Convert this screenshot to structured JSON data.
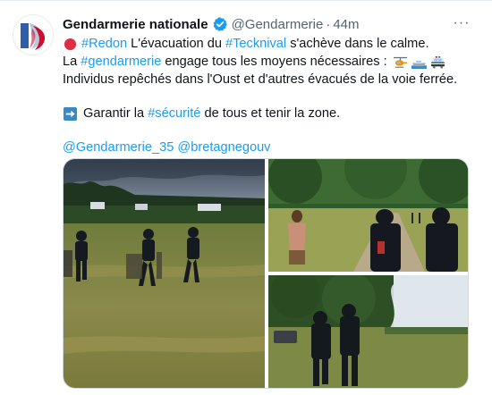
{
  "tweet": {
    "author_name": "Gendarmerie nationale",
    "handle": "@Gendarmerie",
    "separator": "·",
    "time": "44m",
    "more_label": "···",
    "lines": [
      {
        "before": "",
        "tag1": "#Redon",
        "mid": " L'évacuation du ",
        "tag2": "#Tecknival",
        "after": " s'achève dans le calme."
      },
      {
        "before": "La ",
        "tag1": "#gendarmerie",
        "after": " engage tous les moyens nécessaires :"
      },
      {
        "text": "Individus repêchés dans l'Oust et d'autres évacués de la voie ferrée."
      },
      {
        "before": "Garantir la ",
        "tag1": "#sécurité",
        "after": " de tous et tenir la zone."
      }
    ],
    "mentions": [
      "@Gendarmerie_35",
      "@bretagnegouv"
    ]
  },
  "icons": {
    "avatar": "gendarmerie-logo",
    "verified": "verified-badge-icon",
    "status": "red-circle-emoji",
    "means": [
      "helicopter-emoji",
      "boat-emoji",
      "police-car-emoji"
    ],
    "arrow": "right-arrow-emoji",
    "more": "more-options-icon"
  },
  "colors": {
    "link": "#1d9bf0",
    "text": "#0f1419",
    "secondary": "#536471",
    "emoji_red": "#dd2e44"
  },
  "media": {
    "photos": [
      "riot-police-field-photo",
      "riot-police-path-photo",
      "gendarmes-field-edge-photo"
    ]
  }
}
